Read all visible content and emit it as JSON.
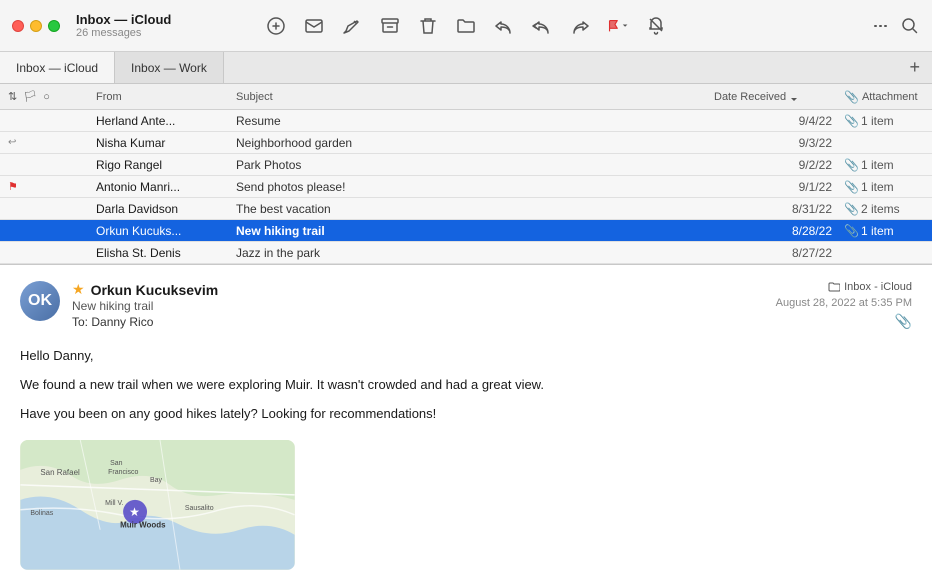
{
  "window": {
    "title": "Inbox — iCloud",
    "subtitle": "26 messages"
  },
  "tabs": [
    {
      "id": "icloud",
      "label": "Inbox — iCloud",
      "active": true
    },
    {
      "id": "work",
      "label": "Inbox — Work",
      "active": false
    }
  ],
  "column_headers": {
    "from": "From",
    "subject": "Subject",
    "date": "Date Received",
    "attachment": "Attachment"
  },
  "emails": [
    {
      "id": 1,
      "flag": "",
      "replied": false,
      "from": "Herland Ante...",
      "subject": "Resume",
      "date": "9/4/22",
      "attachment": "1 item",
      "has_attachment": true
    },
    {
      "id": 2,
      "flag": "",
      "replied": true,
      "from": "Nisha Kumar",
      "subject": "Neighborhood garden",
      "date": "9/3/22",
      "attachment": "",
      "has_attachment": false
    },
    {
      "id": 3,
      "flag": "",
      "replied": false,
      "from": "Rigo Rangel",
      "subject": "Park Photos",
      "date": "9/2/22",
      "attachment": "1 item",
      "has_attachment": true
    },
    {
      "id": 4,
      "flag": "red",
      "replied": false,
      "from": "Antonio Manri...",
      "subject": "Send photos please!",
      "date": "9/1/22",
      "attachment": "1 item",
      "has_attachment": true
    },
    {
      "id": 5,
      "flag": "",
      "replied": false,
      "from": "Darla Davidson",
      "subject": "The best vacation",
      "date": "8/31/22",
      "attachment": "2 items",
      "has_attachment": true
    },
    {
      "id": 6,
      "flag": "",
      "replied": false,
      "from": "Orkun Kucuks...",
      "subject": "New hiking trail",
      "date": "8/28/22",
      "attachment": "1 item",
      "has_attachment": true,
      "selected": true
    },
    {
      "id": 7,
      "flag": "",
      "replied": false,
      "from": "Elisha St. Denis",
      "subject": "Jazz in the park",
      "date": "8/27/22",
      "attachment": "",
      "has_attachment": false
    }
  ],
  "preview": {
    "sender_name": "Orkun Kucuksevim",
    "subject": "New hiking trail",
    "to_label": "To:",
    "to_name": "Danny Rico",
    "inbox_label": "Inbox - iCloud",
    "date": "August 28, 2022 at 5:35 PM",
    "body_line1": "Hello Danny,",
    "body_line2": "We found a new trail when we were exploring Muir. It wasn't crowded and had a great view.",
    "body_line3": "Have you been on any good hikes lately? Looking for recommendations!",
    "avatar_initials": "OK",
    "map_location": "Muir Woods"
  },
  "toolbar": {
    "icons": [
      "compose-icon",
      "mail-icon",
      "edit-icon",
      "archive-icon",
      "trash-icon",
      "folder-icon",
      "reply-icon",
      "reply-all-icon",
      "forward-icon",
      "flag-icon",
      "bell-icon"
    ],
    "more": "more-icon",
    "search": "search-icon"
  }
}
